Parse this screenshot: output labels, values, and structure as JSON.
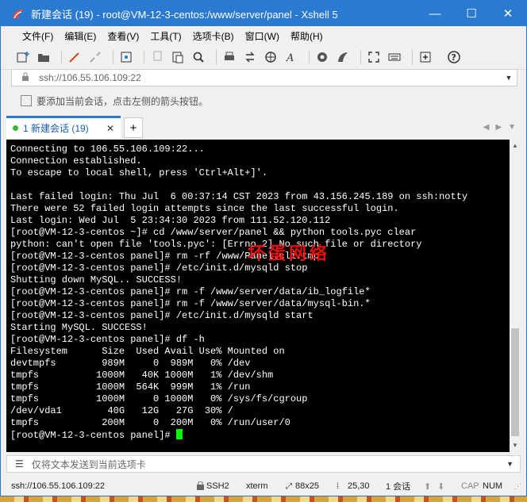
{
  "window": {
    "title": "新建会话 (19) - root@VM-12-3-centos:/www/server/panel - Xshell 5",
    "app_icon": "xshell-icon",
    "controls": {
      "minimize": "—",
      "maximize": "☐",
      "close": "✕"
    }
  },
  "menu": [
    "文件(F)",
    "编辑(E)",
    "查看(V)",
    "工具(T)",
    "选项卡(B)",
    "窗口(W)",
    "帮助(H)"
  ],
  "toolbar": {
    "icons": [
      "new-session-icon",
      "open-folder-icon",
      "connect-icon",
      "disconnect-icon",
      "properties-icon",
      "copy-icon",
      "paste-icon",
      "find-icon",
      "print-icon",
      "transfer-icon",
      "globe-icon",
      "font-icon",
      "xftp-icon",
      "xmanager-icon",
      "fullscreen-icon",
      "keyboard-icon",
      "add-icon",
      "help-icon"
    ]
  },
  "address": {
    "value": "ssh://106.55.106.109:22",
    "dropdown": "▼"
  },
  "hint": {
    "text": "要添加当前会话，点击左侧的箭头按钮。"
  },
  "tabs": [
    {
      "label": "1 新建会话 (19)",
      "active": true,
      "close": "✕"
    }
  ],
  "new_tab": "+",
  "tab_nav": {
    "prev": "◀",
    "next": "▶",
    "menu": "▼"
  },
  "terminal": {
    "lines": [
      "Connecting to 106.55.106.109:22...",
      "Connection established.",
      "To escape to local shell, press 'Ctrl+Alt+]'.",
      "",
      "Last failed login: Thu Jul  6 00:37:14 CST 2023 from 43.156.245.189 on ssh:notty",
      "There were 52 failed login attempts since the last successful login.",
      "Last login: Wed Jul  5 23:34:30 2023 from 111.52.120.112",
      "[root@VM-12-3-centos ~]# cd /www/server/panel && python tools.pyc clear",
      "python: can't open file 'tools.pyc': [Errno 2] No such file or directory",
      "[root@VM-12-3-centos panel]# rm -rf /www/Panel.cli.tmp",
      "[root@VM-12-3-centos panel]# /etc/init.d/mysqld stop",
      "Shutting down MySQL.. SUCCESS!",
      "[root@VM-12-3-centos panel]# rm -f /www/server/data/ib_logfile*",
      "[root@VM-12-3-centos panel]# rm -f /www/server/data/mysql-bin.*",
      "[root@VM-12-3-centos panel]# /etc/init.d/mysqld start",
      "Starting MySQL. SUCCESS!",
      "[root@VM-12-3-centos panel]# df -h",
      "Filesystem      Size  Used Avail Use% Mounted on",
      "devtmpfs        989M     0  989M   0% /dev",
      "tmpfs          1000M   40K 1000M   1% /dev/shm",
      "tmpfs          1000M  564K  999M   1% /run",
      "tmpfs          1000M     0 1000M   0% /sys/fs/cgroup",
      "/dev/vda1        40G   12G   27G  30% /",
      "tmpfs           200M     0  200M   0% /run/user/0"
    ],
    "prompt": "[root@VM-12-3-centos panel]# ",
    "cursor_color": "#00ff00"
  },
  "watermark": "坏蛋网络",
  "send_bar": {
    "placeholder": "仅将文本发送到当前选项卡"
  },
  "status": {
    "address": "ssh://106.55.106.109:22",
    "protocol": "SSH2",
    "terminal": "xterm",
    "size": "88x25",
    "position": "25,30",
    "sessions": "1 会话",
    "caps": "CAP",
    "num": "NUM"
  },
  "colors": {
    "titlebar": "#2b7ad1",
    "tab_text": "#1a5fb4",
    "terminal_bg": "#000000",
    "terminal_fg": "#ffffff",
    "watermark": "#ff1010"
  }
}
